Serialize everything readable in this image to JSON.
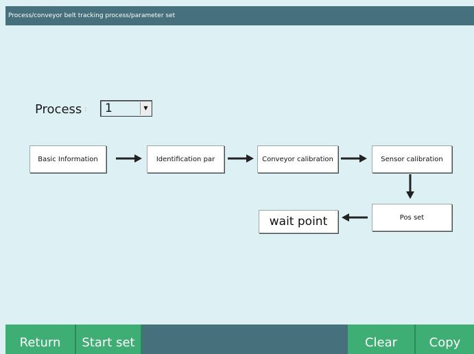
{
  "window": {
    "title": "Process/conveyor belt tracking process/parameter set"
  },
  "process": {
    "label": "Process",
    "colon": ":",
    "selected": "1",
    "dropdown_icon": "caret-down-icon"
  },
  "flow": {
    "basic_info": "Basic Information",
    "identification": "Identification par",
    "conveyor_calibration": "Conveyor calibration",
    "sensor_calibration": "Sensor calibration",
    "pos_set": "Pos set",
    "wait_point": "wait point"
  },
  "toolbar": {
    "return": "Return",
    "start_set": "Start set",
    "clear": "Clear",
    "copy": "Copy"
  },
  "colors": {
    "title_bar": "#45707c",
    "background": "#ddf1f5",
    "button_green": "#3fae74"
  }
}
